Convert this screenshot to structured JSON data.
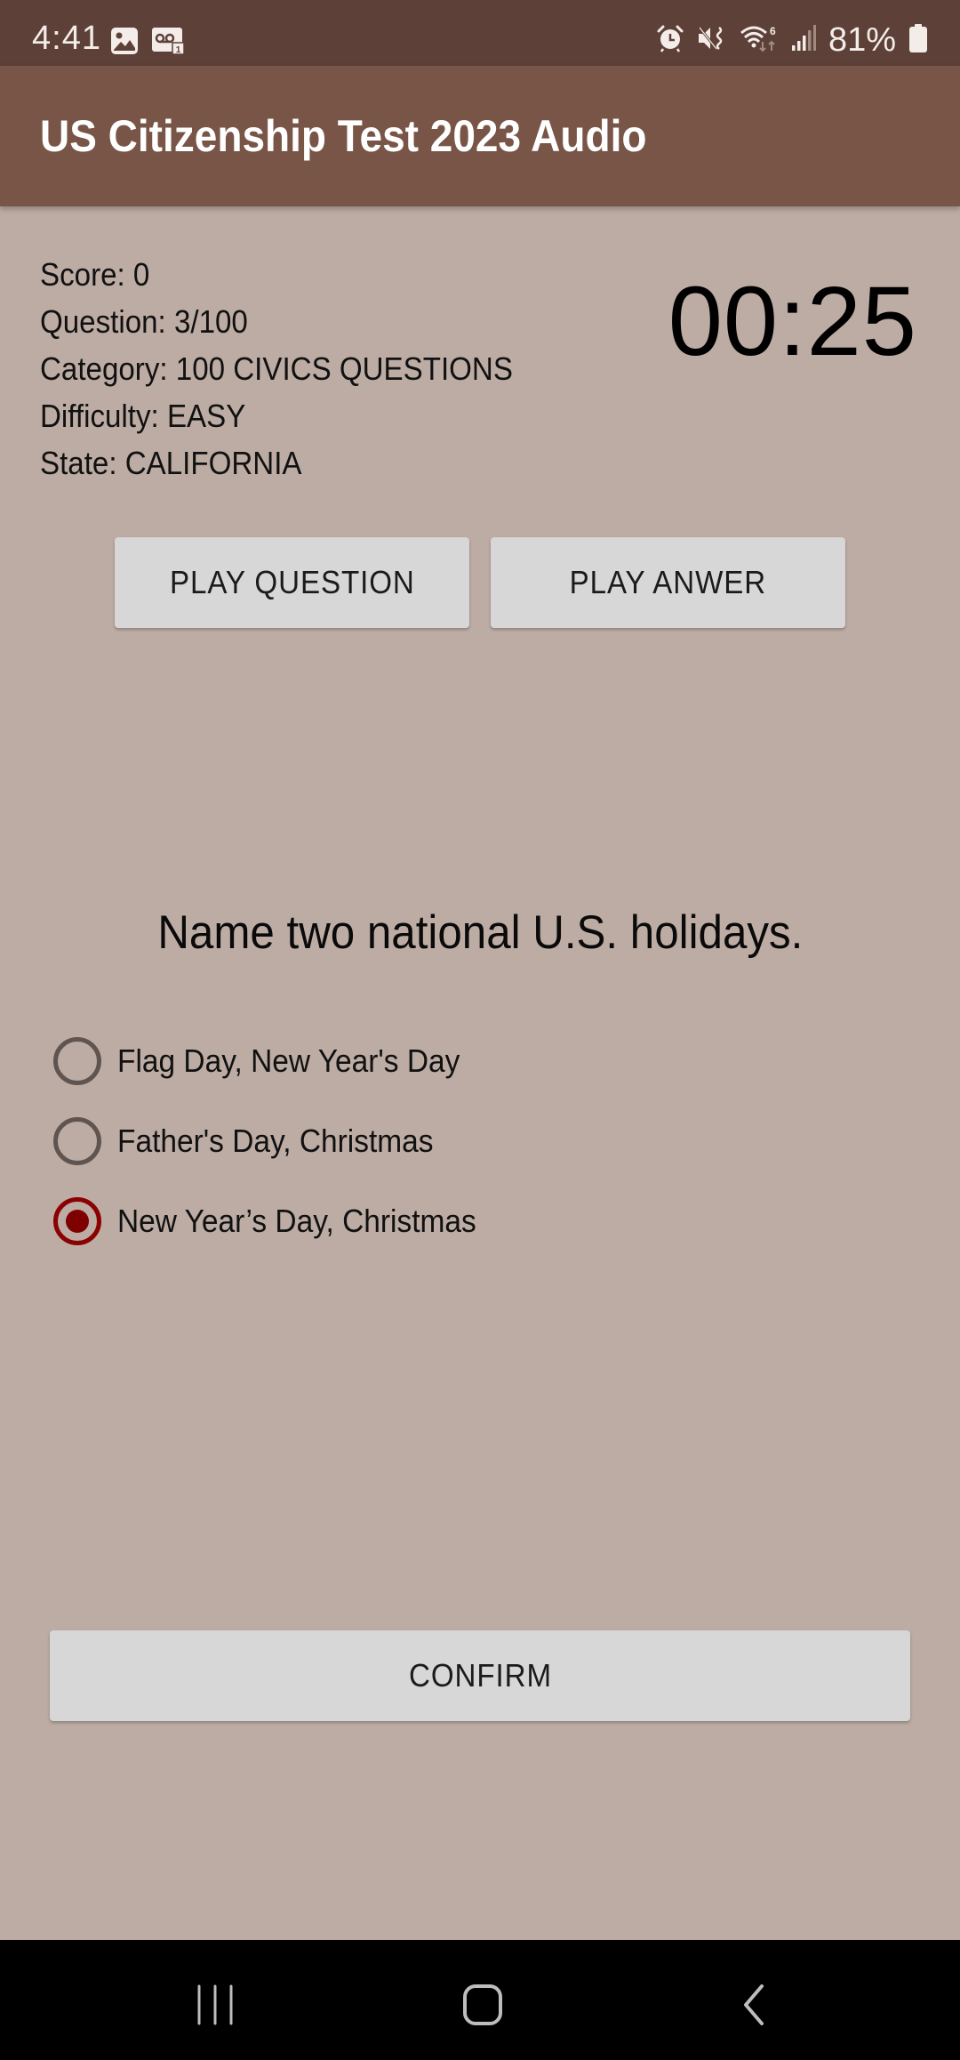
{
  "status_bar": {
    "time": "4:41",
    "left_icons": [
      "gallery-icon",
      "voicemail-icon"
    ],
    "right_icons": [
      "alarm-icon",
      "vibrate-mute-icon",
      "wifi-6-icon",
      "signal-icon"
    ],
    "battery_percent": "81%"
  },
  "app_bar": {
    "title": "US Citizenship Test 2023 Audio"
  },
  "info": {
    "score": "Score: 0",
    "question": "Question: 3/100",
    "category": "Category: 100 CIVICS QUESTIONS",
    "difficulty": "Difficulty: EASY",
    "state": "State: CALIFORNIA"
  },
  "timer": "00:25",
  "buttons": {
    "play_question": "PLAY QUESTION",
    "play_answer": "PLAY ANWER",
    "confirm": "CONFIRM"
  },
  "question_text": "Name two national U.S. holidays.",
  "options": [
    {
      "label": "Flag Day, New Year's Day",
      "checked": false
    },
    {
      "label": "Father's Day, Christmas",
      "checked": false
    },
    {
      "label": "New Year’s Day, Christmas",
      "checked": true
    }
  ],
  "colors": {
    "status_bar": "#5d4037",
    "app_bar": "#795548",
    "background": "#bdaca4",
    "button": "#d6d7d6",
    "radio_checked": "#8b0000"
  },
  "nav_bar": {
    "buttons": [
      "recents-icon",
      "home-icon",
      "back-icon"
    ]
  }
}
